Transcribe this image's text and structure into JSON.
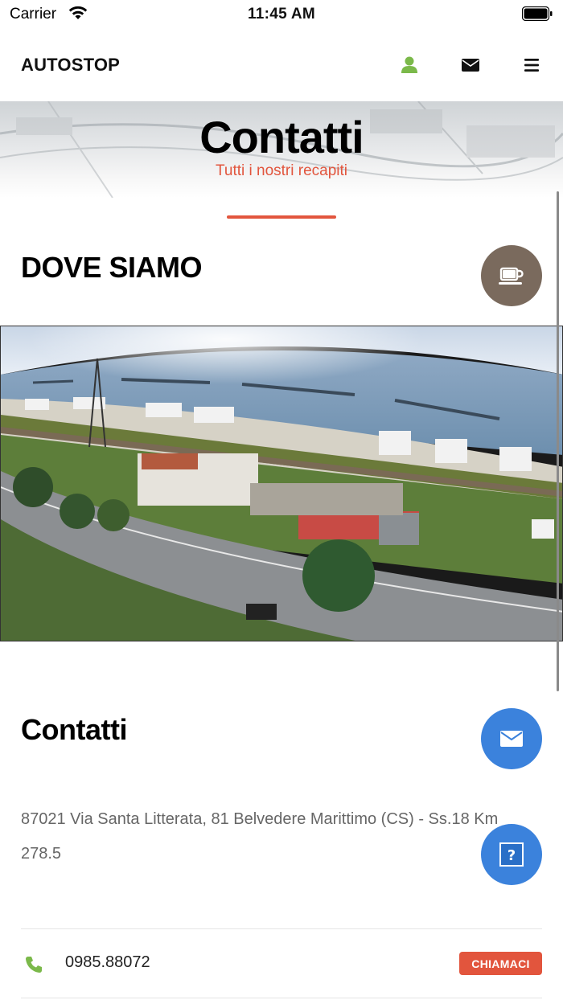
{
  "status_bar": {
    "carrier": "Carrier",
    "time": "11:45 AM"
  },
  "navbar": {
    "brand": "AUTOSTOP",
    "icons": [
      "user-icon",
      "envelope-icon",
      "menu-icon"
    ],
    "user_icon_color": "#7bb94a"
  },
  "hero": {
    "title": "Contatti",
    "subtitle": "Tutti i nostri recapiti"
  },
  "accent_color": "#e2553d",
  "sections": {
    "dove_siamo": {
      "title": "DOVE SIAMO",
      "fab_icon": "coffee-icon",
      "fab_color": "#7a6a5d"
    },
    "contatti": {
      "title": "Contatti",
      "fab_icon": "envelope-icon",
      "fab_color": "#3b82dc",
      "help_icon": "question-icon",
      "address": "87021 Via Santa Litterata, 81 Belvedere Marittimo (CS) - Ss.18 Km 278.5",
      "phone": {
        "icon": "phone-icon",
        "number": "0985.88072",
        "call_label": "CHIAMACI"
      }
    }
  }
}
